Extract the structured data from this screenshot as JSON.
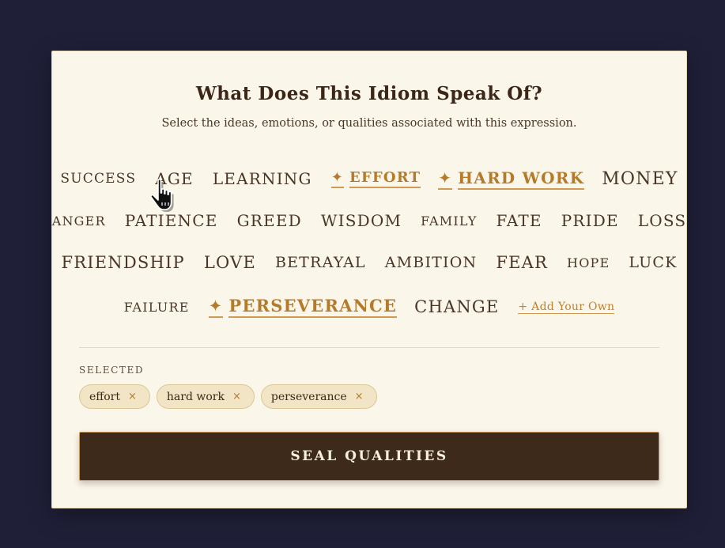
{
  "header": {
    "title": "What Does This Idiom Speak Of?",
    "subtitle": "Select the ideas, emotions, or qualities associated with this expression."
  },
  "words": {
    "success": "SUCCESS",
    "age": "AGE",
    "learning": "LEARNING",
    "effort": "EFFORT",
    "hard_work": "HARD WORK",
    "money": "MONEY",
    "anger": "ANGER",
    "patience": "PATIENCE",
    "greed": "GREED",
    "wisdom": "WISDOM",
    "family": "FAMILY",
    "fate": "FATE",
    "pride": "PRIDE",
    "loss": "LOSS",
    "friendship": "FRIENDSHIP",
    "love": "LOVE",
    "betrayal": "BETRAYAL",
    "ambition": "AMBITION",
    "fear": "FEAR",
    "hope": "HOPE",
    "luck": "LUCK",
    "failure": "FAILURE",
    "perseverance": "PERSEVERANCE",
    "change": "CHANGE"
  },
  "selected_words": [
    "EFFORT",
    "HARD WORK",
    "PERSEVERANCE"
  ],
  "star_glyph": "✦",
  "add_own_label": "+ Add Your Own",
  "selected_section": {
    "label": "SELECTED",
    "chips": [
      "effort",
      "hard work",
      "perseverance"
    ],
    "remove_glyph": "×"
  },
  "seal_button_label": "SEAL QUALITIES",
  "colors": {
    "background": "#1f2038",
    "card": "#fbf6ea",
    "accent": "#b47b2a",
    "button": "#3e2a1b"
  },
  "icons": {
    "selected_marker": "sparkle-icon",
    "cursor": "hand-pointer-cursor-icon"
  }
}
